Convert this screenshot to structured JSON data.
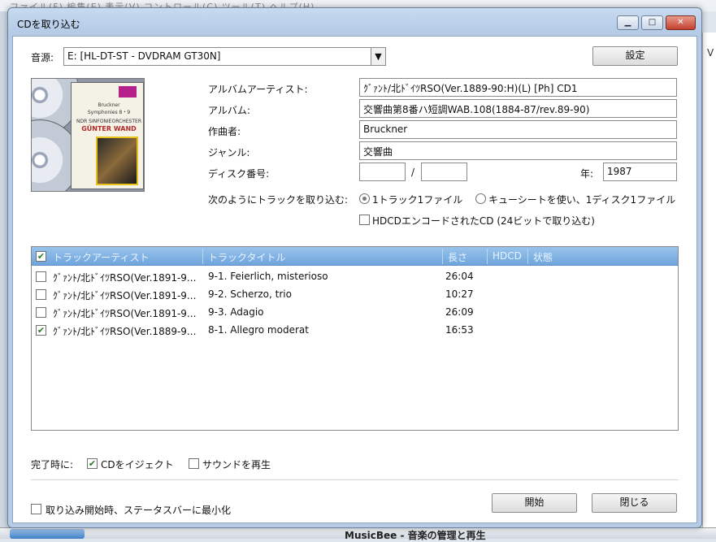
{
  "background": {
    "menu_text": "ファイル(F)    編集(E)    表示(V)    コントロール(C)    ツール(T)    ヘルプ(H)",
    "right_letter": "V",
    "bottom_title": "MusicBee - 音楽の管理と再生"
  },
  "dialog": {
    "title": "CDを取り込む",
    "window_buttons": {
      "minimize": "▁",
      "maximize": "□",
      "close": "✕"
    },
    "source_label": "音源:",
    "source_value": "E: [HL-DT-ST - DVDRAM GT30N]",
    "settings_button": "設定",
    "album_cover": {
      "line1": "Bruckner",
      "line2": "Symphonies 8・9",
      "line3": "NDR SINFONIEORCHESTER",
      "line4": "GÜNTER WAND"
    },
    "fields": {
      "album_artist_label": "アルバムアーティスト:",
      "album_artist_value": "ｸﾞｧﾝﾄ/北ﾄﾞｲﾂRSO(Ver.1889-90:H)(L) [Ph]   CD1",
      "album_label": "アルバム:",
      "album_value": "交響曲第8番ハ短調WAB.108(1884-87/rev.89-90)",
      "composer_label": "作曲者:",
      "composer_value": "Bruckner",
      "genre_label": "ジャンル:",
      "genre_value": "交響曲",
      "disc_label": "ディスク番号:",
      "disc_number": "",
      "disc_total": "",
      "disc_separator": "/",
      "year_label": "年:",
      "year_value": "1987"
    },
    "rip_mode": {
      "label": "次のようにトラックを取り込む:",
      "option1": "1トラック1ファイル",
      "option1_selected": true,
      "option2": "キューシートを使い、1ディスク1ファイル",
      "option2_selected": false,
      "hdcd_label": "HDCDエンコードされたCD (24ビットで取り込む)",
      "hdcd_checked": false
    },
    "table": {
      "headers": {
        "artist": "トラックアーティスト",
        "title": "トラックタイトル",
        "length": "長さ",
        "hdcd": "HDCD",
        "status": "状態"
      },
      "header_check": "✔",
      "rows": [
        {
          "checked": "",
          "artist": "ｸﾞｧﾝﾄ/北ﾄﾞｲﾂRSO(Ver.1891-9...",
          "title": "9-1. Feierlich, misterioso",
          "length": "26:04",
          "hdcd": "",
          "status": ""
        },
        {
          "checked": "",
          "artist": "ｸﾞｧﾝﾄ/北ﾄﾞｲﾂRSO(Ver.1891-9...",
          "title": "9-2. Scherzo, trio",
          "length": "10:27",
          "hdcd": "",
          "status": ""
        },
        {
          "checked": "",
          "artist": "ｸﾞｧﾝﾄ/北ﾄﾞｲﾂRSO(Ver.1891-9...",
          "title": "9-3. Adagio",
          "length": "26:09",
          "hdcd": "",
          "status": ""
        },
        {
          "checked": "✔",
          "artist": "ｸﾞｧﾝﾄ/北ﾄﾞｲﾂRSO(Ver.1889-9...",
          "title": "8-1. Allegro moderat",
          "length": "16:53",
          "hdcd": "",
          "status": ""
        }
      ]
    },
    "on_complete": {
      "label": "完了時に:",
      "eject_label": "CDをイジェクト",
      "eject_checked": "✔",
      "sound_label": "サウンドを再生",
      "sound_checked": ""
    },
    "minimize_label": "取り込み開始時、ステータスバーに最小化",
    "minimize_checked": "",
    "start_button": "開始",
    "close_button": "閉じる"
  }
}
